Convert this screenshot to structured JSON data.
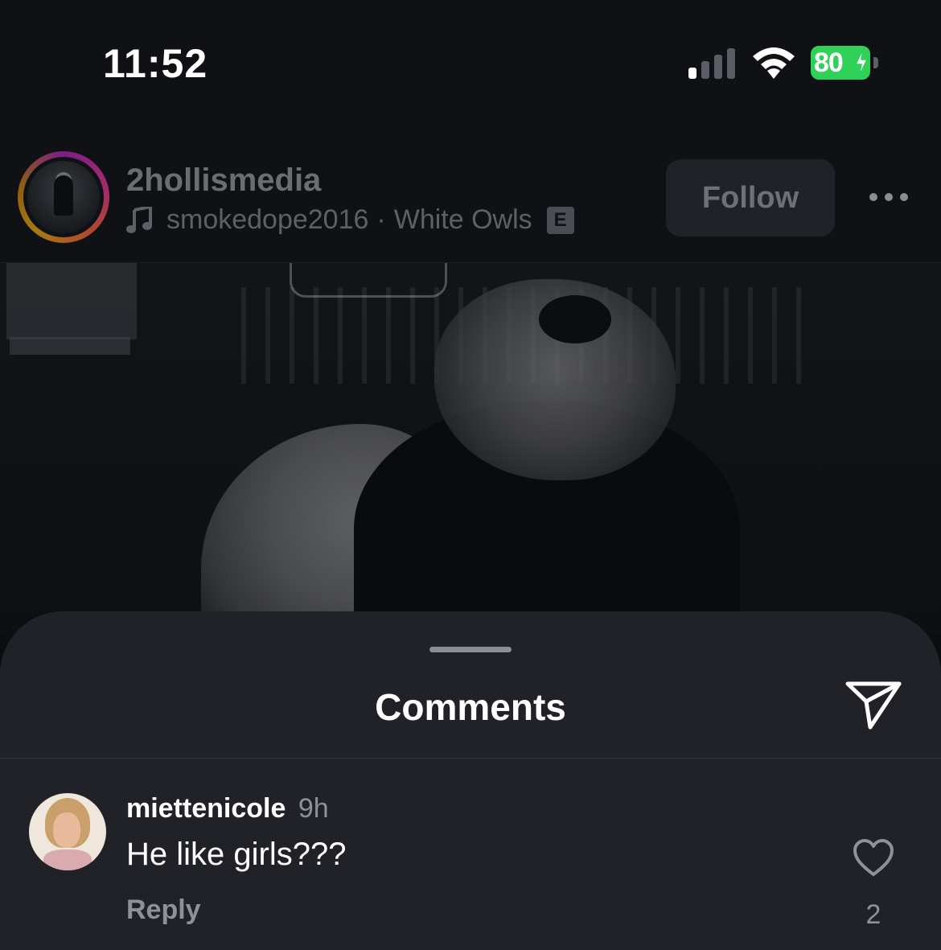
{
  "status_bar": {
    "time": "11:52",
    "battery_percent": "80",
    "charging": true
  },
  "post": {
    "username": "2hollismedia",
    "music_user": "smokedope2016",
    "separator": "·",
    "track": "White Owls",
    "explicit_label": "E",
    "follow_label": "Follow"
  },
  "comments_sheet": {
    "title": "Comments",
    "comments": [
      {
        "username": "miettenicole",
        "time": "9h",
        "text": "He like girls???",
        "reply_label": "Reply",
        "likes": "2"
      }
    ]
  },
  "colors": {
    "battery": "#30d158",
    "sheet_bg": "#202228",
    "muted_text": "#8e9197"
  },
  "icons": [
    "signal-icon",
    "wifi-icon",
    "battery-icon",
    "music-note-icon",
    "more-options-icon",
    "share-icon",
    "heart-icon"
  ]
}
